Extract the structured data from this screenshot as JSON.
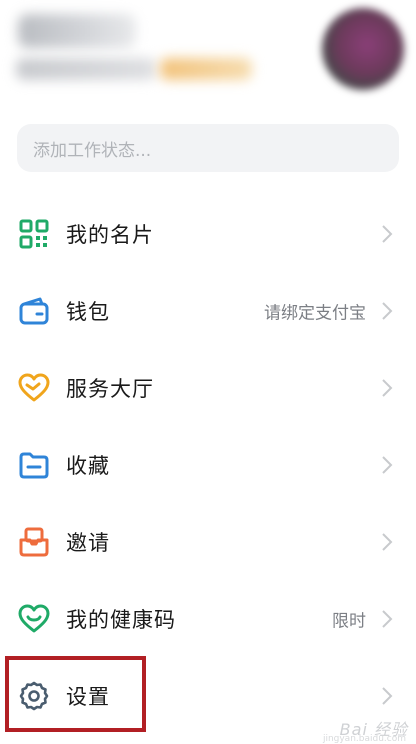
{
  "header": {
    "avatar_icon": "avatar"
  },
  "status": {
    "placeholder": "添加工作状态..."
  },
  "menu": {
    "items": [
      {
        "label": "我的名片",
        "value": "",
        "icon": "qr-code-icon",
        "color": "#1faa67"
      },
      {
        "label": "钱包",
        "value": "请绑定支付宝",
        "icon": "wallet-icon",
        "color": "#2f84d8"
      },
      {
        "label": "服务大厅",
        "value": "",
        "icon": "heart-service-icon",
        "color": "#f0a51c"
      },
      {
        "label": "收藏",
        "value": "",
        "icon": "folder-icon",
        "color": "#2f84d8"
      },
      {
        "label": "邀请",
        "value": "",
        "icon": "invite-icon",
        "color": "#ee6c3d"
      },
      {
        "label": "我的健康码",
        "value": "限时",
        "icon": "health-heart-icon",
        "color": "#1faa67"
      },
      {
        "label": "设置",
        "value": "",
        "icon": "gear-icon",
        "color": "#4a5d6f"
      }
    ]
  },
  "watermark": {
    "text": "Bai 经验",
    "sub": "jingyan.baidu.com"
  },
  "colors": {
    "highlight": "#b21f24",
    "chevron": "#c8cacd"
  }
}
